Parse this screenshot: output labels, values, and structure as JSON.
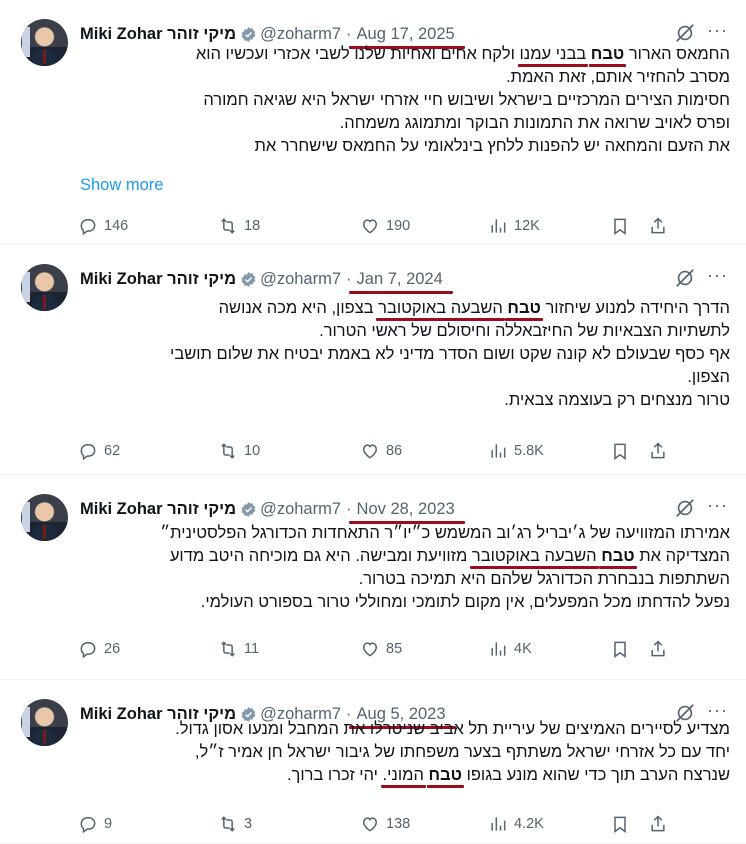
{
  "tweets": [
    {
      "name": "Miki Zohar מיקי זוהר",
      "handle": "@zoharm7",
      "date": "Aug 17, 2025",
      "lines": [
        [
          "החמאס הארור ",
          "טבח",
          " בבני עמנו ולקח אחים ואחיות שלנו לשבי אכזרי ועכשיו הוא"
        ],
        [
          "מסרב להחזיר אותם, זאת האמת."
        ],
        [
          "חסימות הצירים המרכזיים בישראל ושיבוש חיי אזרחי ישראל היא שגיאה חמורה"
        ],
        [
          "ופרס לאויב שרואה את התמונות הבוקר ומתמוגג משמחה."
        ],
        [
          "את הזעם והמחאה יש להפנות ללחץ בינלאומי על החמאס שישחרר את"
        ]
      ],
      "show_more": "Show more",
      "replies": "146",
      "reposts": "18",
      "likes": "190",
      "views": "12K"
    },
    {
      "name": "Miki Zohar מיקי זוהר",
      "handle": "@zoharm7",
      "date": "Jan 7, 2024",
      "lines": [
        [
          "הדרך היחידה למנוע שיחזור ",
          "טבח",
          " השבעה באוקטובר בצפון, היא מכה אנושה"
        ],
        [
          "לתשתיות הצבאיות של החיזבאללה וחיסולם של ראשי הטרור."
        ],
        [
          "אף כסף שבעולם לא קונה שקט ושום הסדר מדיני לא באמת יבטיח את שלום תושבי"
        ],
        [
          "הצפון."
        ],
        [
          "טרור מנצחים רק בעוצמה צבאית."
        ]
      ],
      "show_more": "",
      "replies": "62",
      "reposts": "10",
      "likes": "86",
      "views": "5.8K"
    },
    {
      "name": "Miki Zohar מיקי זוהר",
      "handle": "@zoharm7",
      "date": "Nov 28, 2023",
      "lines": [
        [
          "אמירתו המזוויעה של ג׳יבריל רג׳וב המשמש כ״יו״ר התאחדות הכדורגל הפלסטינית״"
        ],
        [
          "המצדיקה את ",
          "טבח",
          " השבעה באוקטובר מזוויעת ומבישה. היא גם מוכיחה היטב מדוע"
        ],
        [
          "השתתפות בנבחרת הכדורגל שלהם היא תמיכה בטרור."
        ],
        [
          "נפעל להדחתו מכל המפעלים, אין מקום לתומכי ומחוללי טרור בספורט העולמי."
        ]
      ],
      "show_more": "",
      "replies": "26",
      "reposts": "11",
      "likes": "85",
      "views": "4K"
    },
    {
      "name": "Miki Zohar מיקי זוהר",
      "handle": "@zoharm7",
      "date": "Aug 5, 2023",
      "lines": [
        [
          "מצדיע לסיירים האמיצים של עיריית תל אביב שניטרלו את המחבל ומנעו אסון גדול."
        ],
        [
          "יחד עם כל אזרחי ישראל משתתף בצער משפחתו של גיבור ישראל חן אמיר ז״ל,"
        ],
        [
          "שנרצח הערב תוך כדי שהוא מונע בגופו ",
          "טבח",
          " המוני. יהי זכרו ברוך."
        ]
      ],
      "show_more": "",
      "replies": "9",
      "reposts": "3",
      "likes": "138",
      "views": "4.2K"
    }
  ]
}
